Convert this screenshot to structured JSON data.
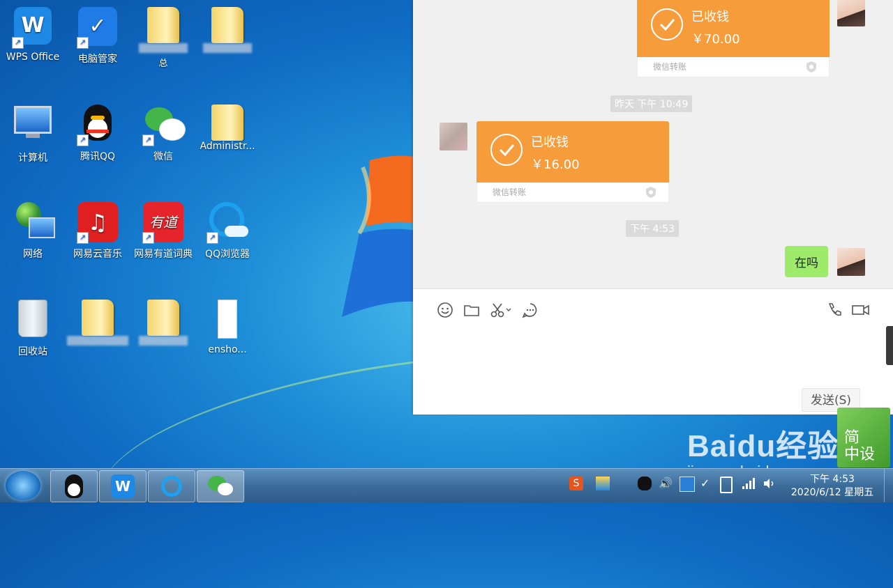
{
  "desktop": {
    "icons": [
      {
        "label": "WPS Office",
        "icon": "wps-icon"
      },
      {
        "label": "电脑管家",
        "icon": "pc-manager-icon"
      },
      {
        "label": "",
        "icon": "folder-icon"
      },
      {
        "label": "",
        "icon": "folder-icon"
      },
      {
        "label": "计算机",
        "icon": "computer-icon"
      },
      {
        "label": "腾讯QQ",
        "icon": "qq-icon"
      },
      {
        "label": "微信",
        "icon": "wechat-icon"
      },
      {
        "label": "Administr...",
        "icon": "user-folder-icon"
      },
      {
        "label": "网络",
        "icon": "network-icon"
      },
      {
        "label": "网易云音乐",
        "icon": "netease-music-icon"
      },
      {
        "label": "网易有道词典",
        "icon": "youdao-icon"
      },
      {
        "label": "QQ浏览器",
        "icon": "qq-browser-icon"
      },
      {
        "label": "回收站",
        "icon": "recycle-bin-icon"
      },
      {
        "label": "",
        "icon": "folder-icon"
      },
      {
        "label": "",
        "icon": "folder-icon"
      },
      {
        "label": "ensho...",
        "icon": "screenshot-file-icon"
      }
    ],
    "folder1_suffix": "总"
  },
  "chat": {
    "transfers": [
      {
        "status": "已收钱",
        "amount": "￥70.00",
        "footer": "微信转账"
      },
      {
        "status": "已收钱",
        "amount": "￥16.00",
        "footer": "微信转账"
      }
    ],
    "timestamps": [
      "昨天 下午 10:49",
      "下午 4:53"
    ],
    "message": "在吗",
    "send_button": "发送(S)"
  },
  "watermark": {
    "brand": "Baidu经验",
    "url": "jingyan.baidu.com",
    "badge": "简\n中设"
  },
  "taskbar": {
    "time": "下午 4:53",
    "date": "2020/6/12 星期五"
  },
  "colors": {
    "transfer": "#f79c3a",
    "bubble": "#9eea6a"
  }
}
